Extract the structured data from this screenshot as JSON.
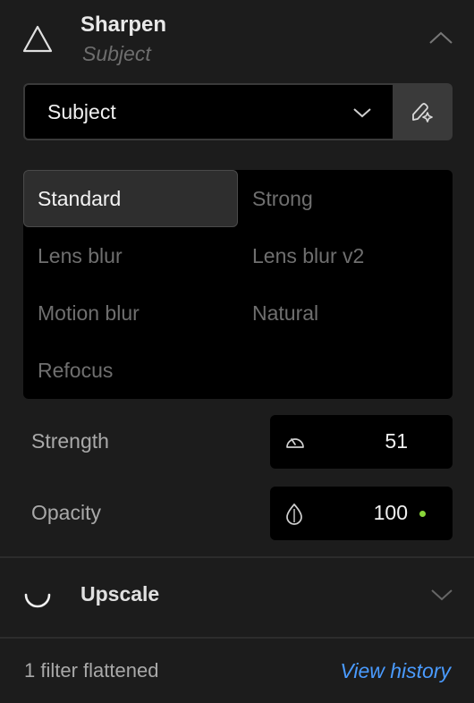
{
  "sharpen": {
    "title": "Sharpen",
    "subtitle": "Subject",
    "header_icon": "triangle-icon",
    "collapse_icon": "chevron-up-icon"
  },
  "subject_select": {
    "value": "Subject",
    "icon": "chevron-down-icon",
    "mask_button_icon": "mask-brush-icon"
  },
  "models": {
    "selected": "Standard",
    "options": [
      "Standard",
      "Strong",
      "Lens blur",
      "Lens blur v2",
      "Motion blur",
      "Natural",
      "Refocus"
    ]
  },
  "params": {
    "strength": {
      "label": "Strength",
      "value": "51",
      "icon": "gauge-icon"
    },
    "opacity": {
      "label": "Opacity",
      "value": "100",
      "icon": "droplet-icon",
      "indicator_color": "#8ad63a"
    }
  },
  "upscale": {
    "title": "Upscale",
    "icon": "spinner-icon",
    "expand_icon": "chevron-down-icon"
  },
  "footer": {
    "status": "1 filter flattened",
    "link": "View history",
    "link_color": "#4a9bff"
  }
}
